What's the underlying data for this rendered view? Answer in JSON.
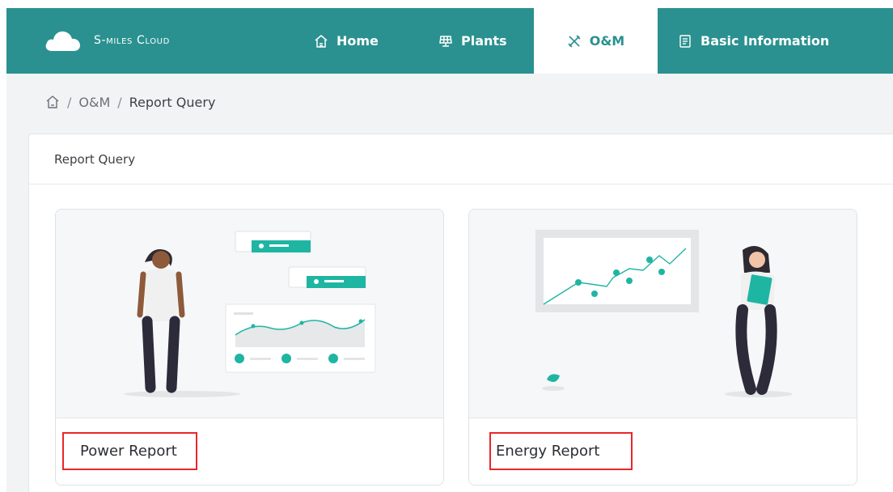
{
  "brand": {
    "name": "S-miles Cloud",
    "logo_icon": "cloud-icon"
  },
  "nav": {
    "items": [
      {
        "label": "Home",
        "icon": "home-icon",
        "active": false
      },
      {
        "label": "Plants",
        "icon": "solar-panel-icon",
        "active": false
      },
      {
        "label": "O&M",
        "icon": "tools-icon",
        "active": true
      },
      {
        "label": "Basic Information",
        "icon": "info-sheet-icon",
        "active": false
      }
    ]
  },
  "breadcrumb": {
    "home_icon": "home-icon",
    "separator": "/",
    "items": [
      "O&M",
      "Report Query"
    ]
  },
  "panel": {
    "title": "Report Query",
    "cards": [
      {
        "label": "Power Report",
        "illustration": "man-with-chart-illustration"
      },
      {
        "label": "Energy Report",
        "illustration": "woman-with-board-illustration"
      }
    ]
  },
  "colors": {
    "nav_bg": "#2a9190",
    "accent": "#1fb5a3",
    "highlight_border": "#e8262b",
    "page_bg": "#f2f3f5"
  }
}
